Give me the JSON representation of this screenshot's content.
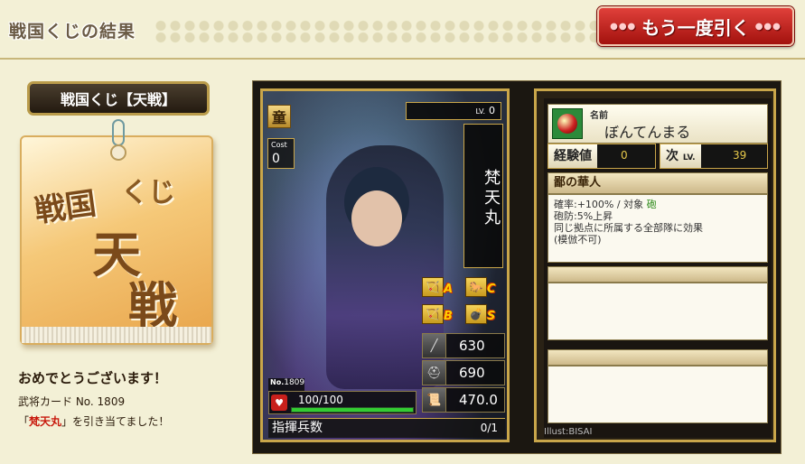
{
  "header": {
    "title": "戦国くじの結果",
    "redraw_button": "もう一度引く"
  },
  "left": {
    "kuji_label": "戦国くじ【天戦】",
    "box_text": [
      "戦国",
      "くじ",
      "天",
      "戦"
    ],
    "congrats": "おめでとうございます！",
    "card_no_text": "武将カード No. 1809",
    "draw_message_prefix": "「",
    "draw_message_name": "梵天丸",
    "draw_message_suffix": "」を引き当てました！"
  },
  "card": {
    "rank": "童",
    "cost_label": "Cost",
    "cost_value": "0",
    "lv_label": "LV.",
    "lv_value": "0",
    "name": "梵天丸",
    "grades": [
      "A",
      "C",
      "B",
      "S"
    ],
    "stats": [
      {
        "icon": "spear-icon",
        "value": "630"
      },
      {
        "icon": "helmet-icon",
        "value": "690"
      },
      {
        "icon": "scroll-icon",
        "value": "470.0"
      }
    ],
    "no_label": "No.",
    "no_value": "1809",
    "hp_text": "100/100",
    "hp_fraction": 1.0,
    "troops_label": "指揮兵数",
    "troops_value": "0/1"
  },
  "info": {
    "name_label": "名前",
    "name_value": "ぼんてんまる",
    "exp_label": "経験値",
    "exp_value": "0",
    "next_label": "次",
    "next_lv": "LV.",
    "next_value": "39",
    "skill_name": "鄙の華人",
    "skill_line1_prefix": "確率:+100%  /  対象 ",
    "skill_target": "砲",
    "skill_line2": "砲防:5%上昇",
    "skill_line3": "同じ拠点に所属する全部隊に効果",
    "skill_line4": "(模倣不可)",
    "illustrator": "Illust:BISAI"
  }
}
